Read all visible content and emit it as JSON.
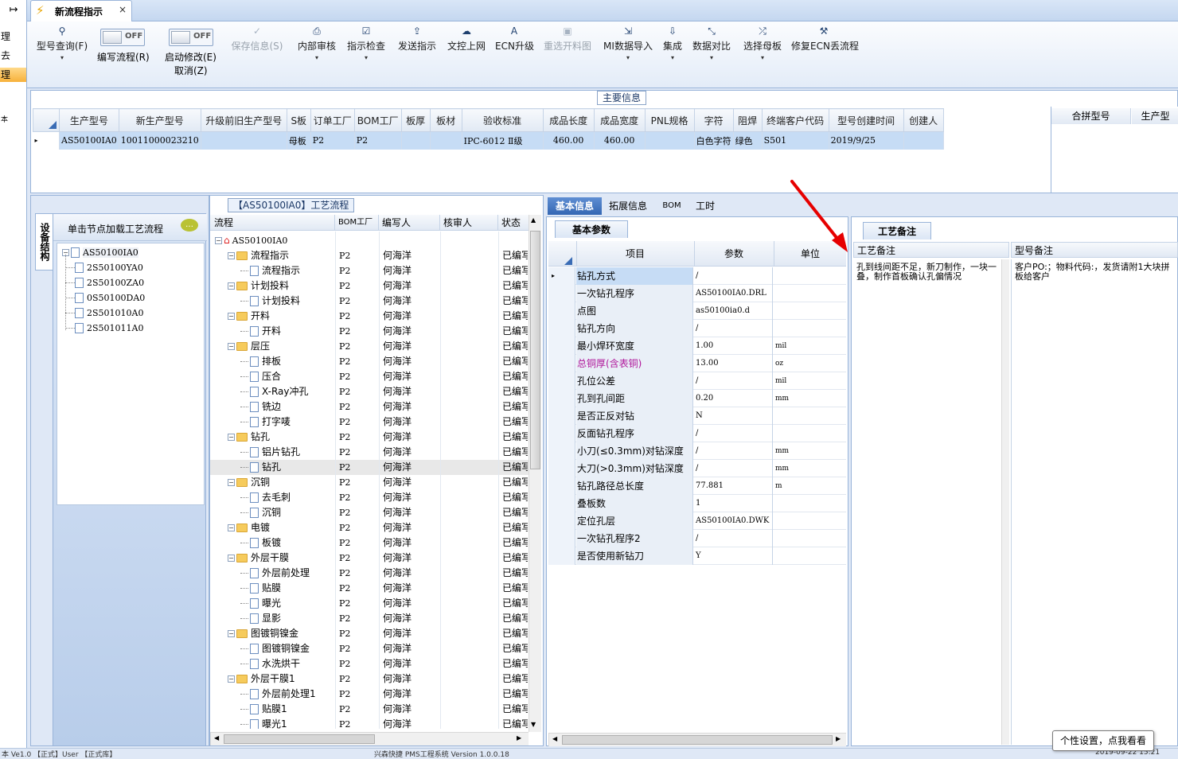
{
  "left_strip": {
    "exit_icon": "↦",
    "items": [
      "理",
      "去",
      "理",
      "本"
    ]
  },
  "tab": {
    "title": "新流程指示",
    "close": "×"
  },
  "ribbon": {
    "buttons": [
      {
        "id": "query",
        "icon": "search-icon",
        "glyph": "⚲",
        "label": "型号查询(F)",
        "dropdown": "▾",
        "disabled": false
      },
      {
        "id": "save",
        "icon": "check-icon",
        "glyph": "✓",
        "label": "保存信息(S)",
        "dropdown": "",
        "disabled": true
      },
      {
        "id": "review",
        "icon": "printer-icon",
        "glyph": "⎙",
        "label": "内部审核",
        "dropdown": "▾",
        "disabled": false
      },
      {
        "id": "check",
        "icon": "checkbox-icon",
        "glyph": "☑",
        "label": "指示检查",
        "dropdown": "▾",
        "disabled": false
      },
      {
        "id": "send",
        "icon": "upload-icon",
        "glyph": "⇪",
        "label": "发送指示",
        "dropdown": "",
        "disabled": false
      },
      {
        "id": "docup",
        "icon": "cloud-upload-icon",
        "glyph": "☁",
        "label": "文控上网",
        "dropdown": "",
        "disabled": false
      },
      {
        "id": "ecn",
        "icon": "font-icon",
        "glyph": "A",
        "label": "ECN升级",
        "dropdown": "",
        "disabled": false
      },
      {
        "id": "recut",
        "icon": "image-icon",
        "glyph": "▣",
        "label": "重选开料图",
        "dropdown": "",
        "disabled": true
      },
      {
        "id": "mi",
        "icon": "import-icon",
        "glyph": "⇲",
        "label": "MI数据导入",
        "dropdown": "▾",
        "disabled": false
      },
      {
        "id": "integrate",
        "icon": "download-icon",
        "glyph": "⇩",
        "label": "集成",
        "dropdown": "▾",
        "disabled": false
      },
      {
        "id": "compare",
        "icon": "compress-icon",
        "glyph": "⤡",
        "label": "数据对比",
        "dropdown": "▾",
        "disabled": false
      },
      {
        "id": "template",
        "icon": "shuffle-icon",
        "glyph": "⤮",
        "label": "选择母板",
        "dropdown": "▾",
        "disabled": false
      },
      {
        "id": "fix",
        "icon": "wrench-icon",
        "glyph": "⚒",
        "label": "修复ECN丢流程",
        "dropdown": "",
        "disabled": false
      }
    ],
    "toggle1": {
      "label": "编写流程(R)",
      "state": "OFF"
    },
    "toggle2": {
      "label": "启动修改(E)",
      "sub": "取消(Z)",
      "state": "OFF"
    }
  },
  "main_info": {
    "title": "主要信息",
    "columns": [
      "生产型号",
      "新生产型号",
      "升级前旧生产型号",
      "S板",
      "订单工厂",
      "BOM工厂",
      "板厚",
      "板材",
      "验收标准",
      "成品长度",
      "成品宽度",
      "PNL规格",
      "字符",
      "阻焊",
      "终端客户代码",
      "型号创建时间",
      "创建人"
    ],
    "row": {
      "marker": "▸",
      "cells": [
        "AS50100IA0",
        "10011000023210",
        "",
        "母板",
        "P2",
        "P2",
        "",
        "",
        "IPC-6012 Ⅱ级",
        "460.00",
        "460.00",
        "",
        "白色字符",
        "绿色",
        "S501",
        "2019/9/25",
        ""
      ]
    },
    "side_columns": [
      "合拼型号",
      "生产型"
    ]
  },
  "device_panel": {
    "vertical_tab": "设备结构",
    "hint": "单击节点加载工艺流程",
    "root": "AS50100IA0",
    "nodes": [
      "2S50100YA0",
      "2S50100ZA0",
      "0S50100DA0",
      "2S501010A0",
      "2S501011A0"
    ]
  },
  "process_panel": {
    "title": "【AS50100IA0】工艺流程",
    "columns": [
      "流程",
      "BOM工厂",
      "编写人",
      "核审人",
      "状态"
    ],
    "root": "AS50100IA0",
    "rows": [
      {
        "name": "流程指示",
        "level": 1,
        "folder": true,
        "factory": "P2",
        "writer": "何海洋",
        "status": "已编写"
      },
      {
        "name": "流程指示",
        "level": 2,
        "folder": false,
        "factory": "P2",
        "writer": "何海洋",
        "status": "已编写"
      },
      {
        "name": "计划投料",
        "level": 1,
        "folder": true,
        "factory": "P2",
        "writer": "何海洋",
        "status": "已编写"
      },
      {
        "name": "计划投料",
        "level": 2,
        "folder": false,
        "factory": "P2",
        "writer": "何海洋",
        "status": "已编写"
      },
      {
        "name": "开料",
        "level": 1,
        "folder": true,
        "factory": "P2",
        "writer": "何海洋",
        "status": "已编写"
      },
      {
        "name": "开料",
        "level": 2,
        "folder": false,
        "factory": "P2",
        "writer": "何海洋",
        "status": "已编写"
      },
      {
        "name": "层压",
        "level": 1,
        "folder": true,
        "factory": "P2",
        "writer": "何海洋",
        "status": "已编写"
      },
      {
        "name": "排板",
        "level": 2,
        "folder": false,
        "factory": "P2",
        "writer": "何海洋",
        "status": "已编写"
      },
      {
        "name": "压合",
        "level": 2,
        "folder": false,
        "factory": "P2",
        "writer": "何海洋",
        "status": "已编写"
      },
      {
        "name": "X-Ray冲孔",
        "level": 2,
        "folder": false,
        "factory": "P2",
        "writer": "何海洋",
        "status": "已编写"
      },
      {
        "name": "铣边",
        "level": 2,
        "folder": false,
        "factory": "P2",
        "writer": "何海洋",
        "status": "已编写"
      },
      {
        "name": "打字唛",
        "level": 2,
        "folder": false,
        "factory": "P2",
        "writer": "何海洋",
        "status": "已编写"
      },
      {
        "name": "钻孔",
        "level": 1,
        "folder": true,
        "factory": "P2",
        "writer": "何海洋",
        "status": "已编写"
      },
      {
        "name": "铝片钻孔",
        "level": 2,
        "folder": false,
        "factory": "P2",
        "writer": "何海洋",
        "status": "已编写"
      },
      {
        "name": "钻孔",
        "level": 2,
        "folder": false,
        "factory": "P2",
        "writer": "何海洋",
        "status": "已编写",
        "selected": true
      },
      {
        "name": "沉铜",
        "level": 1,
        "folder": true,
        "factory": "P2",
        "writer": "何海洋",
        "status": "已编写"
      },
      {
        "name": "去毛刺",
        "level": 2,
        "folder": false,
        "factory": "P2",
        "writer": "何海洋",
        "status": "已编写"
      },
      {
        "name": "沉铜",
        "level": 2,
        "folder": false,
        "factory": "P2",
        "writer": "何海洋",
        "status": "已编写"
      },
      {
        "name": "电镀",
        "level": 1,
        "folder": true,
        "factory": "P2",
        "writer": "何海洋",
        "status": "已编写"
      },
      {
        "name": "板镀",
        "level": 2,
        "folder": false,
        "factory": "P2",
        "writer": "何海洋",
        "status": "已编写"
      },
      {
        "name": "外层干膜",
        "level": 1,
        "folder": true,
        "factory": "P2",
        "writer": "何海洋",
        "status": "已编写"
      },
      {
        "name": "外层前处理",
        "level": 2,
        "folder": false,
        "factory": "P2",
        "writer": "何海洋",
        "status": "已编写"
      },
      {
        "name": "贴膜",
        "level": 2,
        "folder": false,
        "factory": "P2",
        "writer": "何海洋",
        "status": "已编写"
      },
      {
        "name": "曝光",
        "level": 2,
        "folder": false,
        "factory": "P2",
        "writer": "何海洋",
        "status": "已编写"
      },
      {
        "name": "显影",
        "level": 2,
        "folder": false,
        "factory": "P2",
        "writer": "何海洋",
        "status": "已编写"
      },
      {
        "name": "图镀铜镍金",
        "level": 1,
        "folder": true,
        "factory": "P2",
        "writer": "何海洋",
        "status": "已编写"
      },
      {
        "name": "图镀铜镍金",
        "level": 2,
        "folder": false,
        "factory": "P2",
        "writer": "何海洋",
        "status": "已编写"
      },
      {
        "name": "水洗烘干",
        "level": 2,
        "folder": false,
        "factory": "P2",
        "writer": "何海洋",
        "status": "已编写"
      },
      {
        "name": "外层干膜1",
        "level": 1,
        "folder": true,
        "factory": "P2",
        "writer": "何海洋",
        "status": "已编写"
      },
      {
        "name": "外层前处理1",
        "level": 2,
        "folder": false,
        "factory": "P2",
        "writer": "何海洋",
        "status": "已编写"
      },
      {
        "name": "贴膜1",
        "level": 2,
        "folder": false,
        "factory": "P2",
        "writer": "何海洋",
        "status": "已编写"
      },
      {
        "name": "曝光1",
        "level": 2,
        "folder": false,
        "factory": "P2",
        "writer": "何海洋",
        "status": "已编写"
      }
    ]
  },
  "detail_tabs": [
    "基本信息",
    "拓展信息",
    "BOM",
    "工时"
  ],
  "params": {
    "subtab": "基本参数",
    "columns": [
      "项目",
      "参数",
      "单位"
    ],
    "rows": [
      {
        "item": "钻孔方式",
        "value": "/",
        "unit": "",
        "current": true
      },
      {
        "item": "一次钻孔程序",
        "value": "AS50100IA0.DRL",
        "unit": ""
      },
      {
        "item": "点图",
        "value": "as50100ia0.d",
        "unit": ""
      },
      {
        "item": "钻孔方向",
        "value": "/",
        "unit": ""
      },
      {
        "item": "最小焊环宽度",
        "value": "1.00",
        "unit": "mil"
      },
      {
        "item": "总铜厚(含表铜)",
        "value": "13.00",
        "unit": "oz",
        "highlight": true
      },
      {
        "item": "孔位公差",
        "value": "/",
        "unit": "mil"
      },
      {
        "item": "孔到孔间距",
        "value": "0.20",
        "unit": "mm"
      },
      {
        "item": "是否正反对钻",
        "value": "N",
        "unit": ""
      },
      {
        "item": "反面钻孔程序",
        "value": "/",
        "unit": ""
      },
      {
        "item": "小刀(≤0.3mm)对钻深度",
        "value": "/",
        "unit": "mm"
      },
      {
        "item": "大刀(>0.3mm)对钻深度",
        "value": "/",
        "unit": "mm"
      },
      {
        "item": "钻孔路径总长度",
        "value": "77.881",
        "unit": "m"
      },
      {
        "item": "叠板数",
        "value": "1",
        "unit": ""
      },
      {
        "item": "定位孔层",
        "value": "AS50100IA0.DWK",
        "unit": ""
      },
      {
        "item": "一次钻孔程序2",
        "value": "/",
        "unit": ""
      },
      {
        "item": "是否使用新钻刀",
        "value": "Y",
        "unit": ""
      }
    ]
  },
  "remarks": {
    "tab": "工艺备注",
    "process_header": "工艺备注",
    "model_header": "型号备注",
    "process_text": "孔到线间距不足，新刀制作，一块一叠，制作首板确认孔偏情况",
    "model_text": "客户PO:；物料代码:，发货请附1大块拼板给客户"
  },
  "tooltip": "个性设置，点我看看",
  "status_bar": {
    "left": "本    Ve1.0 【正式】User 【正式库】",
    "mid": "兴森快捷 PMS工程系统 Version 1.0.0.18",
    "right": "2019-09-22 15:21"
  },
  "colors": {
    "accent": "#4a78c2",
    "arrow": "#e60000",
    "highlight_text": "#b0179b",
    "selection": "#c6dcf5"
  }
}
